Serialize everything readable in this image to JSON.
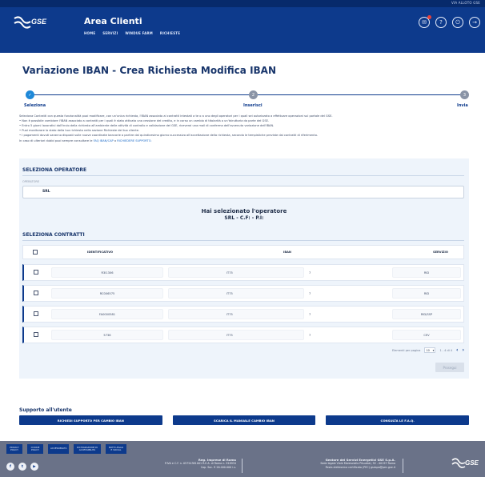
{
  "header": {
    "meta": "VIA ALLOTO GSE",
    "logo_text": "GSE",
    "app_title": "Area Clienti",
    "nav": [
      "HOME",
      "SERVIZI",
      "WINDUE FARM",
      "RICHIESTE"
    ],
    "icons": [
      "notification-icon",
      "help-icon",
      "power-icon",
      "logout-icon"
    ]
  },
  "page_title": "Variazione IBAN - Crea Richiesta Modifica IBAN",
  "stepper": {
    "steps": [
      {
        "num": "✓",
        "label": "Seleziona"
      },
      {
        "num": "2",
        "label": "Inserisci"
      },
      {
        "num": "3",
        "label": "Invia"
      }
    ]
  },
  "intro": {
    "p1": "Seleziona Contratti con questa funzionalità puoi modificare, con un'unica richiesta, l'IBAN associato ai contratti intestati a te o a uno degli operatori per i quali sei autorizzato a effettuare operazioni sul portale del GSE.",
    "b1": "• Non è possibile cambiare l'IBAN associato a contratti per i quali è stata attivata una cessione del credito, e in corso un cambio di titolarità o un'istruttoria da parte del GSE.",
    "b2": "• Entro 5 giorni lavorativi dall'invio della richiesta all'ambiente delle attività di controllo e validazione del GSE, riceverai una mail di conferma dell'avvenuta variazione dell'IBAN.",
    "b3": "• Puoi monitorare lo stato della tua richiesta nella sezione Richieste del tuo cliente.",
    "b4": "• I pagamenti dovuti saranno disposti sulle nuove coordinate bancarie a partire dal quindicesimo giorno successivo all'accettazione della richiesta, secondo le tempistiche previste dai contratti di riferimento.",
    "help_prefix": "In caso di ulteriori dubbi puoi sempre consultare le ",
    "help_link1": "FAQ IBAN/CAP",
    "help_mid": " o ",
    "help_link2": "RICHIEDERE SUPPORTO."
  },
  "operator": {
    "section_title": "SELEZIONA OPERATORE",
    "field_label": "OPERATORE",
    "field_value": "SRL",
    "selected_line1": "Hai selezionato l'operatore",
    "selected_line2": "SRL - C.F:                    - P.I:"
  },
  "contracts": {
    "section_title": "SELEZIONA CONTRATTI",
    "columns": [
      "IDENTIFICATIVO",
      "IBAN",
      "SERVIZIO"
    ],
    "rows": [
      {
        "id": "R3I1306",
        "iban": "IT75",
        "mark": "7",
        "service": "RID"
      },
      {
        "id": "RC006575",
        "iban": "IT75",
        "mark": "7",
        "service": "RID"
      },
      {
        "id": "FA0000581",
        "iban": "IT75",
        "mark": "7",
        "service": "RID/SSP"
      },
      {
        "id": "5736",
        "iban": "IT75",
        "mark": "7",
        "service": "CEV"
      }
    ],
    "pager": {
      "per_page_label": "Elementi per pagina",
      "per_page_value": "10",
      "range": "1 - 4 di 4",
      "prev": "‹",
      "next": "›"
    },
    "proceed_label": "Prosegui"
  },
  "support": {
    "title": "Supporto all'utente",
    "buttons": [
      "RICHIEDI SUPPORTO PER CAMBIO IBAN",
      "SCARICA IL MANUALE CAMBIO IBAN",
      "CONSULTA LE F.A.Q."
    ]
  },
  "footer": {
    "links": [
      "PRIVACY POLICY",
      "COOKIE POLICY",
      "ACCESSIBILITÀ",
      "DICHIARAZIONE DI ACCESSIBILITÀ",
      "NOTE LEGALI E SOCIAL"
    ],
    "social": [
      "f",
      "t",
      "▶"
    ],
    "block1_title": "Reg. Imprese di Roma",
    "block1_line1": "P.IVA e C.F. n. 05754381001 R.E.A. di Roma n. 918934",
    "block1_line2": "Cap. Soc. € 26.000.000 i.v.",
    "block2_title": "Gestore dei Servizi Energetici GSE S.p.A.",
    "block2_line1": "Sede legale Viale Maresciallo Pilsudski, 92 - 00197 Roma",
    "block2_line2": "Posta elettronica certificata (PEC) gsespa@pec.gse.it",
    "logo_text": "GSE"
  },
  "colors": {
    "brand": "#0d3a8c",
    "accent": "#1e88d8",
    "panel": "#eef4fb",
    "footer": "#6a7288"
  }
}
